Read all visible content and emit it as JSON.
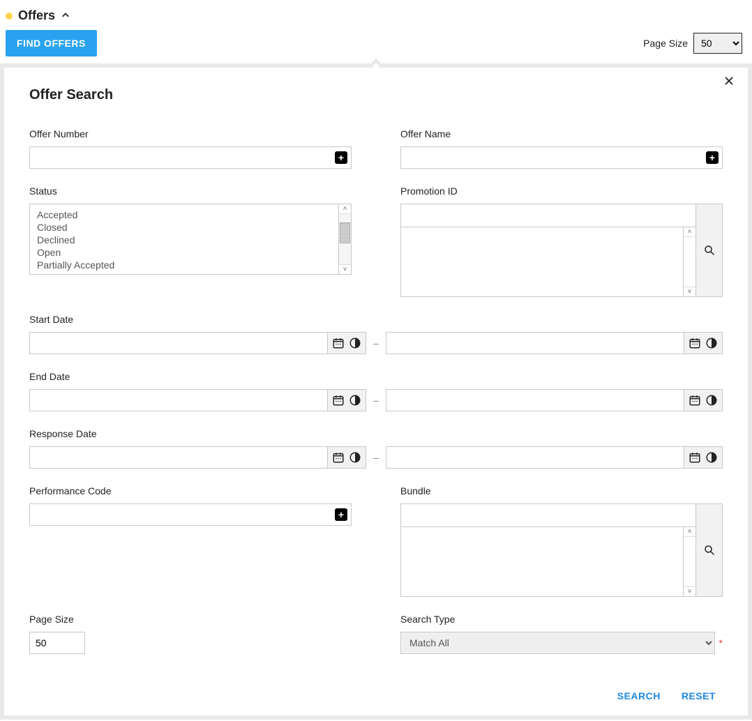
{
  "header": {
    "title": "Offers"
  },
  "toolbar": {
    "find_label": "FIND OFFERS",
    "page_size_label": "Page Size",
    "page_size_value": "50"
  },
  "search": {
    "title": "Offer Search",
    "offer_number_label": "Offer Number",
    "offer_name_label": "Offer Name",
    "status_label": "Status",
    "status_options": [
      "Accepted",
      "Closed",
      "Declined",
      "Open",
      "Partially Accepted"
    ],
    "promotion_id_label": "Promotion ID",
    "start_date_label": "Start Date",
    "end_date_label": "End Date",
    "response_date_label": "Response Date",
    "performance_code_label": "Performance Code",
    "bundle_label": "Bundle",
    "page_size_label": "Page Size",
    "page_size_value": "50",
    "search_type_label": "Search Type",
    "search_type_value": "Match All",
    "search_button": "SEARCH",
    "reset_button": "RESET",
    "dash": "–"
  }
}
